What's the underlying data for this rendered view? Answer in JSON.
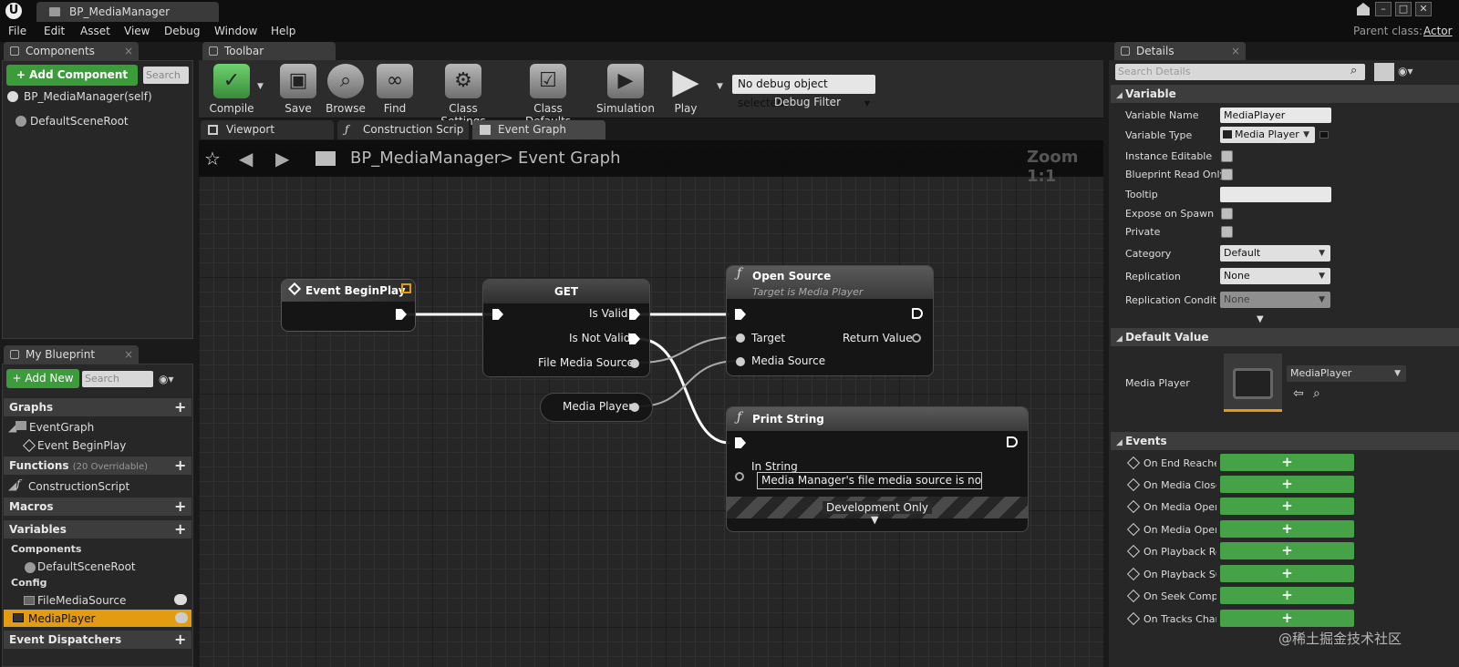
{
  "window": {
    "tab_title": "BP_MediaManager",
    "logo": "ue-logo-icon",
    "controls": [
      "minimize-icon",
      "maximize-icon",
      "close-icon"
    ]
  },
  "menu": [
    "File",
    "Edit",
    "Asset",
    "View",
    "Debug",
    "Window",
    "Help"
  ],
  "parent_class": {
    "label": "Parent class:",
    "value": "Actor"
  },
  "components": {
    "tab": "Components",
    "add_button": "+ Add Component",
    "search_placeholder": "Search",
    "items": [
      "BP_MediaManager(self)",
      "DefaultSceneRoot"
    ]
  },
  "my_blueprint": {
    "tab": "My Blueprint",
    "add_new": "+ Add New",
    "search_placeholder": "Search",
    "sections": {
      "graphs": "Graphs",
      "event_graph": "EventGraph",
      "event_beginplay": "Event BeginPlay",
      "functions": "Functions",
      "functions_note": "(20 Overridable)",
      "construction_script": "ConstructionScript",
      "macros": "Macros",
      "variables": "Variables",
      "components_cat": "Components",
      "default_scene_root": "DefaultSceneRoot",
      "config": "Config",
      "file_media_source": "FileMediaSource",
      "media_player": "MediaPlayer",
      "event_dispatchers": "Event Dispatchers"
    }
  },
  "toolbar": {
    "tab": "Toolbar",
    "compile": "Compile",
    "save": "Save",
    "browse": "Browse",
    "find": "Find",
    "class_settings": "Class Settings",
    "class_defaults": "Class Defaults",
    "simulation": "Simulation",
    "play": "Play",
    "debug_object": "No debug object selected",
    "debug_filter": "Debug Filter"
  },
  "graph_tabs": [
    "Viewport",
    "Construction Scrip",
    "Event Graph"
  ],
  "graph": {
    "breadcrumb_root": "BP_MediaManager",
    "breadcrumb_sep": ">",
    "breadcrumb_current": "Event Graph",
    "zoom": "Zoom 1:1",
    "nodes": {
      "begin_play": "Event BeginPlay",
      "get": "GET",
      "is_valid": "Is Valid",
      "is_not_valid": "Is Not Valid",
      "file_media_source": "File Media Source",
      "media_player": "Media Player",
      "open_source": "Open Source",
      "open_source_sub": "Target is Media Player",
      "target": "Target",
      "return_value": "Return Value",
      "media_source": "Media Source",
      "print_string": "Print String",
      "in_string": "In String",
      "in_string_value": "Media Manager's file media source is not set!",
      "development_only": "Development Only"
    }
  },
  "details": {
    "tab": "Details",
    "search_placeholder": "Search Details",
    "variable_section": "Variable",
    "rows": {
      "variable_name": "Variable Name",
      "variable_name_value": "MediaPlayer",
      "variable_type": "Variable Type",
      "variable_type_value": "Media Player",
      "instance_editable": "Instance Editable",
      "blueprint_read_only": "Blueprint Read Only",
      "tooltip": "Tooltip",
      "expose_on_spawn": "Expose on Spawn",
      "private": "Private",
      "category": "Category",
      "category_value": "Default",
      "replication": "Replication",
      "replication_value": "None",
      "replication_condition": "Replication Conditio",
      "replication_condition_value": "None"
    },
    "default_value_section": "Default Value",
    "media_player_label": "Media Player",
    "media_player_value": "MediaPlayer",
    "events_section": "Events",
    "events": [
      "On End Reached",
      "On Media Closed",
      "On Media Opened",
      "On Media Opened Failed",
      "On Playback Resumed",
      "On Playback Suspended",
      "On Seek Completed",
      "On Tracks Changed"
    ]
  },
  "watermark": "@稀土掘金技术社区"
}
